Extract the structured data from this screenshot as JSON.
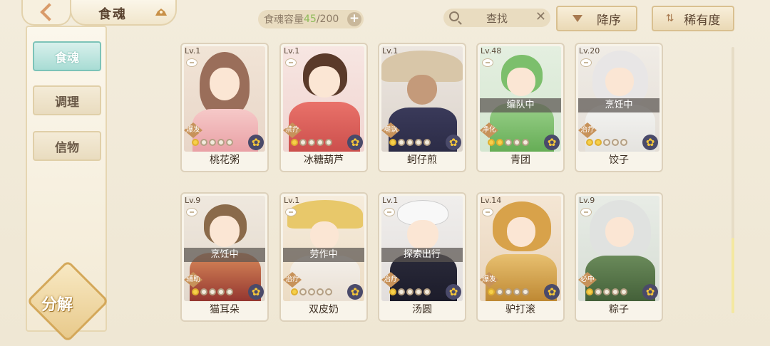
{
  "header": {
    "title": "食魂",
    "capacity_label": "食魂容量 ",
    "capacity_current": "45",
    "capacity_total": "/200",
    "search_text": "查找",
    "sort_label": "降序",
    "rarity_label": "稀有度"
  },
  "sidebar": {
    "items": [
      {
        "label": "食魂"
      },
      {
        "label": "调理"
      },
      {
        "label": "信物"
      }
    ],
    "decompose_label": "分解"
  },
  "cards": [
    {
      "level": "Lv.1",
      "role": "爆发",
      "name": "桃花粥",
      "status": "",
      "stars": 0
    },
    {
      "level": "Lv.1",
      "role": "禁疗",
      "name": "冰糖葫芦",
      "status": "",
      "stars": 0
    },
    {
      "level": "Lv.1",
      "role": "嘲讽",
      "name": "蚵仔煎",
      "status": "",
      "stars": 0
    },
    {
      "level": "Lv.48",
      "role": "净化",
      "name": "青团",
      "status": "编队中",
      "stars": 0
    },
    {
      "level": "Lv.20",
      "role": "治疗",
      "name": "饺子",
      "status": "烹饪中",
      "stars": 1
    },
    {
      "level": "Lv.9",
      "role": "辅助",
      "name": "猫耳朵",
      "status": "烹饪中",
      "stars": 0
    },
    {
      "level": "Lv.1",
      "role": "治疗",
      "name": "双皮奶",
      "status": "劳作中",
      "stars": 0
    },
    {
      "level": "Lv.1",
      "role": "治疗",
      "name": "汤圆",
      "status": "探索出行",
      "stars": 0
    },
    {
      "level": "Lv.14",
      "role": "爆发",
      "name": "驴打滚",
      "status": "",
      "stars": 0
    },
    {
      "level": "Lv.9",
      "role": "必中",
      "name": "粽子",
      "status": "",
      "stars": 0
    }
  ],
  "colors": {
    "accent_teal": "#a8dcd4",
    "capacity_green": "#8fbc5a",
    "gold": "#f6d04a"
  }
}
